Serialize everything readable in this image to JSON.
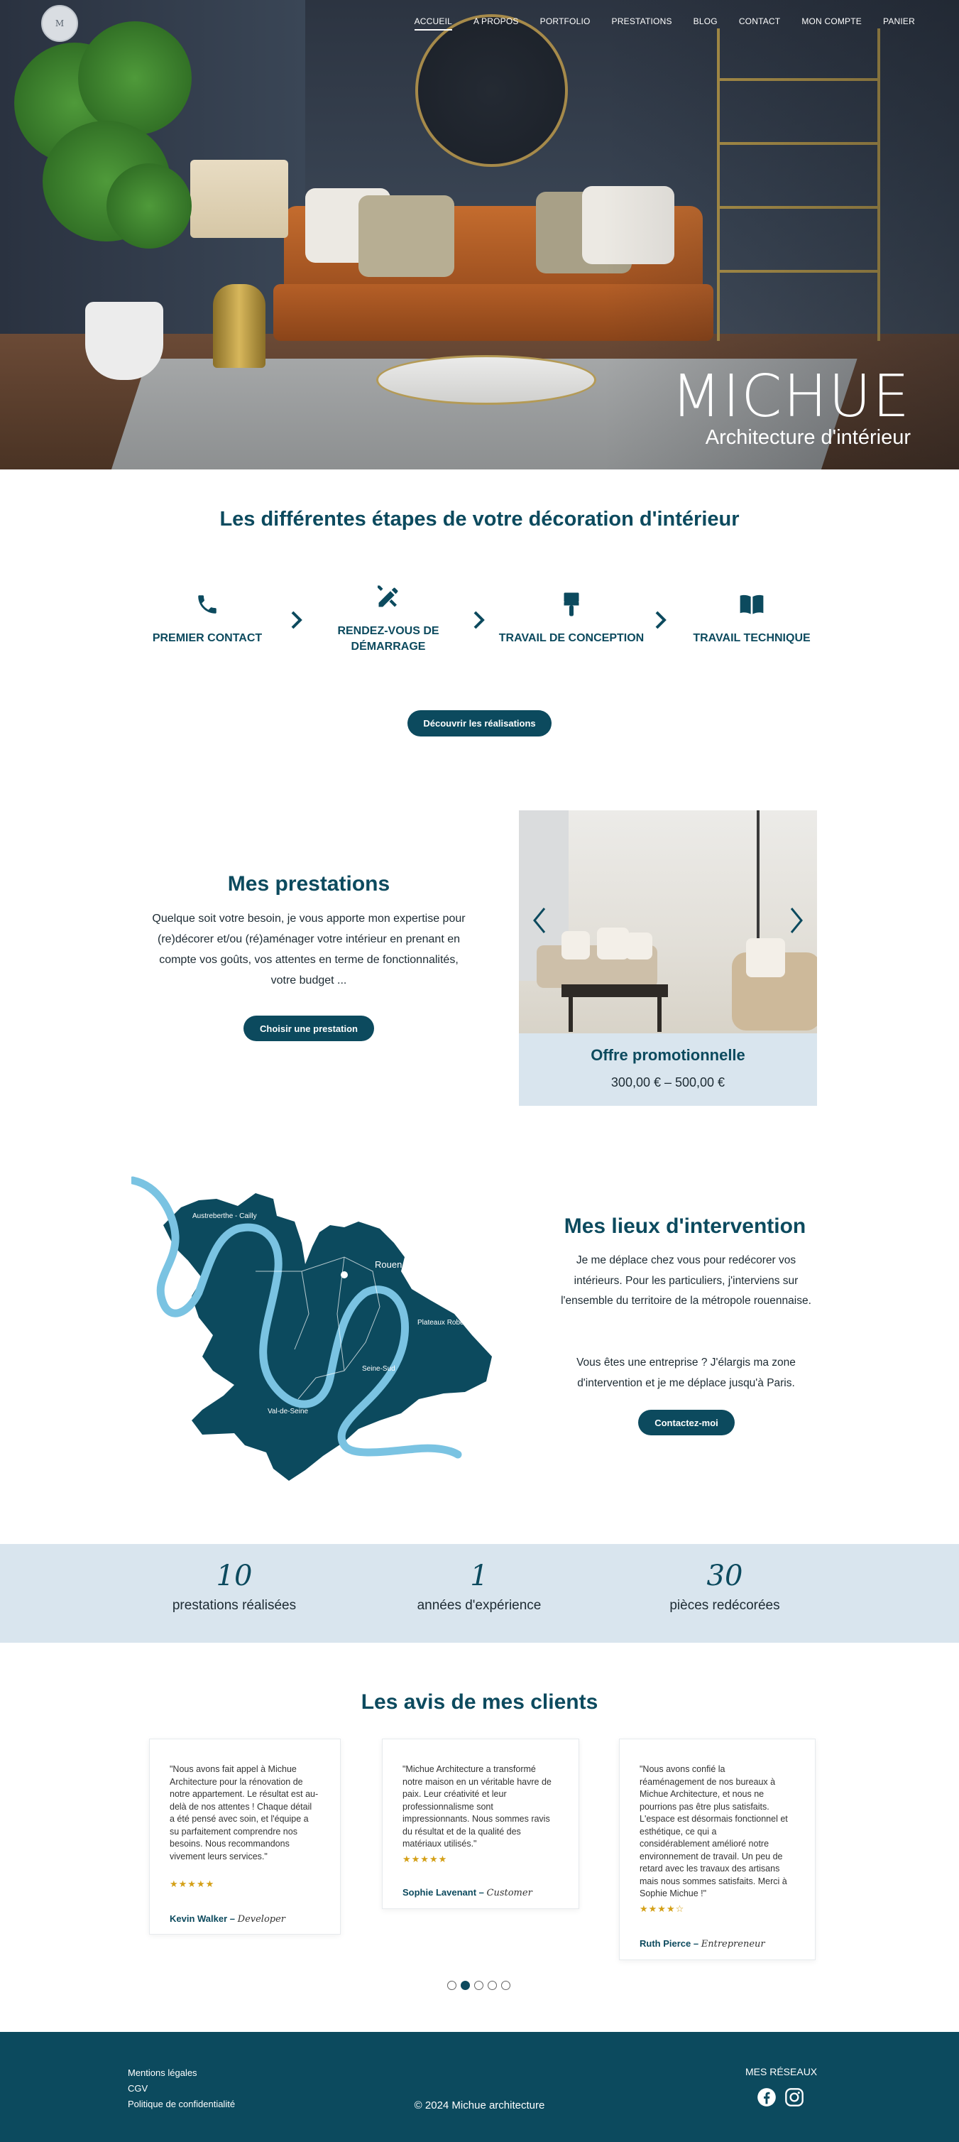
{
  "nav": {
    "logo_text": "M",
    "items": [
      {
        "label": "ACCUEIL"
      },
      {
        "label": "A PROPOS"
      },
      {
        "label": "PORTFOLIO"
      },
      {
        "label": "PRESTATIONS"
      },
      {
        "label": "BLOG"
      },
      {
        "label": "CONTACT"
      },
      {
        "label": "MON COMPTE"
      },
      {
        "label": "PANIER"
      }
    ]
  },
  "hero": {
    "title": "MICHUE",
    "subtitle": "Architecture d'intérieur"
  },
  "steps": {
    "title": "Les différentes étapes de votre décoration d'intérieur",
    "items": [
      {
        "label": "PREMIER CONTACT",
        "icon": "phone-icon"
      },
      {
        "label": "RENDEZ-VOUS DE DÉMARRAGE",
        "icon": "tools-icon"
      },
      {
        "label": "TRAVAIL DE CONCEPTION",
        "icon": "paint-brush-icon"
      },
      {
        "label": "TRAVAIL TECHNIQUE",
        "icon": "book-icon"
      }
    ],
    "cta": "Découvrir les réalisations"
  },
  "prestations": {
    "title": "Mes prestations",
    "text": "Quelque soit votre besoin, je vous apporte mon expertise pour (re)décorer et/ou (ré)aménager votre intérieur en prenant en compte vos goûts, vos attentes en terme de fonctionnalités, votre budget ...",
    "cta": "Choisir une prestation",
    "slide": {
      "title": "Offre promotionnelle",
      "price": "300,00 € – 500,00 €"
    }
  },
  "lieux": {
    "title": "Mes lieux d'intervention",
    "text1": "Je me déplace chez vous pour redécorer vos intérieurs. Pour les particuliers, j'interviens sur l'ensemble du territoire de la métropole rouennaise.",
    "text2": "Vous êtes une entreprise ? J'élargis ma zone d'intervention et je me déplace jusqu'à Paris.",
    "cta": "Contactez-moi",
    "map_labels": {
      "a": "Austreberthe - Cailly",
      "b": "Rouen",
      "c": "Plateaux Robec",
      "d": "Seine-Sud",
      "e": "Val-de-Seine"
    }
  },
  "stats": [
    {
      "num": "10",
      "label": "prestations réalisées"
    },
    {
      "num": "1",
      "label": "années d'expérience"
    },
    {
      "num": "30",
      "label": "pièces redécorées"
    }
  ],
  "reviews": {
    "title": "Les avis de mes clients",
    "items": [
      {
        "text": "\"Nous avons fait appel à Michue Architecture pour la rénovation de notre appartement. Le résultat est au-delà de nos attentes ! Chaque détail a été pensé avec soin, et l'équipe a su parfaitement comprendre nos besoins. Nous recommandons vivement leurs services.\"",
        "stars": "★★★★★",
        "author": "Kevin Walker",
        "role": "Developer"
      },
      {
        "text": "\"Michue Architecture a transformé notre maison en un véritable havre de paix. Leur créativité et leur professionnalisme sont impressionnants. Nous sommes ravis du résultat et de la qualité des matériaux utilisés.\"",
        "stars": "★★★★★",
        "author": "Sophie Lavenant",
        "role": "Customer"
      },
      {
        "text": "\"Nous avons confié la réaménagement de nos bureaux à Michue Architecture, et nous ne pourrions pas être plus satisfaits. L'espace est désormais fonctionnel et esthétique, ce qui a considérablement amélioré notre environnement de travail. Un peu de retard avec les travaux des artisans mais nous sommes satisfaits. Merci à Sophie Michue !\"",
        "stars": "★★★★☆",
        "author": "Ruth Pierce",
        "role": "Entrepreneur"
      }
    ],
    "dash": "–",
    "dots": 5,
    "active_dot": 2
  },
  "footer": {
    "links": [
      "Mentions légales",
      "CGV",
      "Politique de confidentialité"
    ],
    "copyright": "© 2024 Michue architecture",
    "social_title": "MES RÉSEAUX"
  },
  "colors": {
    "primary": "#0c4a5e",
    "light_bg": "#d9e5ee",
    "star": "#d4a017"
  }
}
